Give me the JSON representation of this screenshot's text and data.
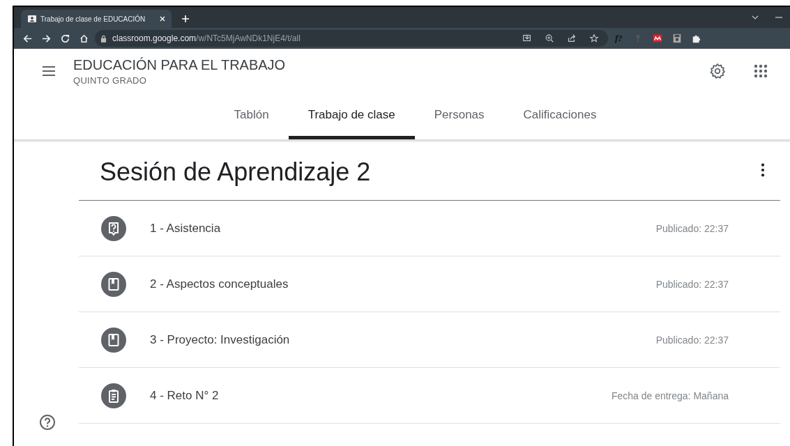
{
  "browser": {
    "tab_title": "Trabajo de clase de EDUCACIÓN",
    "url_host": "classroom.google.com",
    "url_path": "/w/NTc5MjAwNDk1NjE4/t/all"
  },
  "class": {
    "title": "EDUCACIÓN PARA EL TRABAJO",
    "subtitle": "QUINTO GRADO"
  },
  "tabs": [
    {
      "label": "Tablón",
      "selected": false
    },
    {
      "label": "Trabajo de clase",
      "selected": true
    },
    {
      "label": "Personas",
      "selected": false
    },
    {
      "label": "Calificaciones",
      "selected": false
    }
  ],
  "topic": {
    "title": "Sesión de Aprendizaje 2"
  },
  "items": [
    {
      "kind": "question",
      "title": "1 - Asistencia",
      "meta": "Publicado: 22:37"
    },
    {
      "kind": "material",
      "title": "2 - Aspectos conceptuales",
      "meta": "Publicado: 22:37"
    },
    {
      "kind": "material",
      "title": "3 - Proyecto: Investigación",
      "meta": "Publicado: 22:37"
    },
    {
      "kind": "assignment",
      "title": "4 - Reto N° 2",
      "meta": "Fecha de entrega: Mañana"
    }
  ],
  "browser_extension_label": "f?"
}
